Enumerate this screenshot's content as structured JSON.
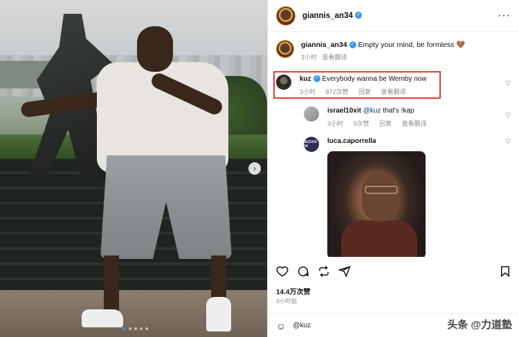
{
  "post": {
    "username": "giannis_an34",
    "more_icon": "more-icon",
    "caption_user": "giannis_an34",
    "caption_text": "Empty your mind, be formless",
    "caption_emoji": "🤎",
    "caption_time": "3小时",
    "caption_translate": "查看翻译"
  },
  "comments": [
    {
      "user": "kuz",
      "verified": true,
      "text": "Everybody wanna be Wemby now",
      "time": "3小时",
      "likes": "872次赞",
      "reply": "回复",
      "translate": "查看翻译"
    },
    {
      "user": "israel10xit",
      "mention": "@kuz",
      "text": "that's !kap",
      "time": "3小时",
      "likes": "9次赞",
      "reply": "回复",
      "translate": "查看翻译"
    },
    {
      "user": "luca.caporrella",
      "avatar_text": "BUCKS 34"
    }
  ],
  "footer": {
    "likes": "14.4万次赞",
    "time": "3小时前",
    "comment_value": "@kuz",
    "watermark": "头条 @力道塾"
  },
  "colors": {
    "verified": "#3897f0",
    "highlight": "#e53935",
    "meta": "#8e8e8e"
  }
}
